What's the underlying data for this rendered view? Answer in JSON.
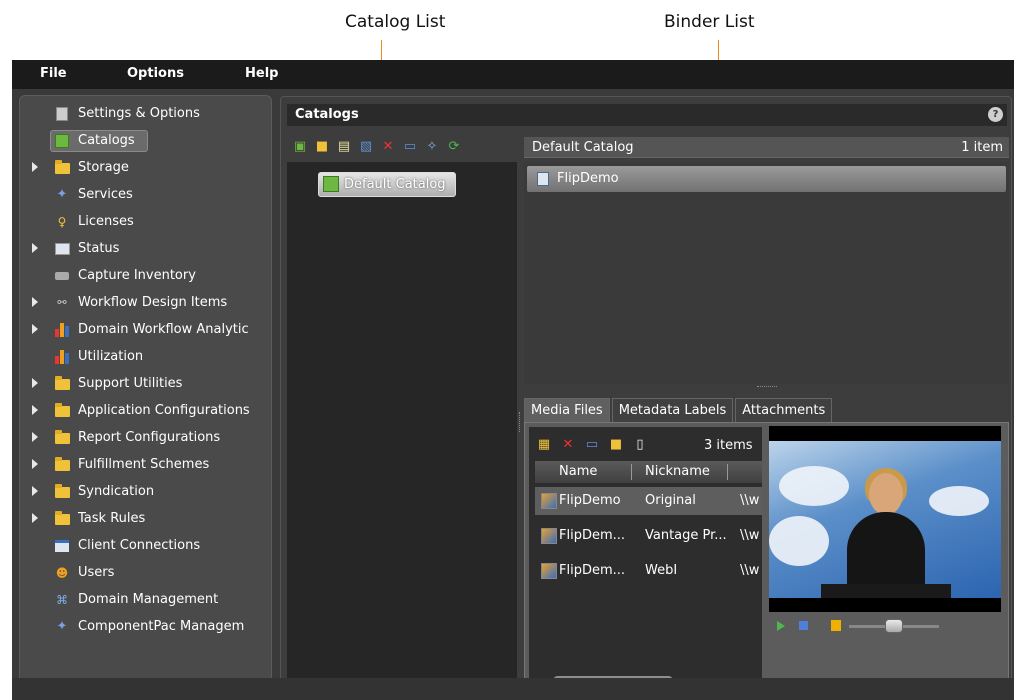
{
  "callouts": {
    "catalog_list": "Catalog List",
    "binder_list": "Binder List"
  },
  "menu": {
    "file": "File",
    "options": "Options",
    "help": "Help"
  },
  "nav": {
    "items": [
      {
        "label": "Settings & Options",
        "icon": "settings-icon",
        "expandable": false
      },
      {
        "label": "Catalogs",
        "icon": "catalogs-icon",
        "expandable": false,
        "selected": true
      },
      {
        "label": "Storage",
        "icon": "folder-icon",
        "expandable": true
      },
      {
        "label": "Services",
        "icon": "services-icon",
        "expandable": false
      },
      {
        "label": "Licenses",
        "icon": "key-icon",
        "expandable": false
      },
      {
        "label": "Status",
        "icon": "chart-icon",
        "expandable": true
      },
      {
        "label": "Capture Inventory",
        "icon": "camera-icon",
        "expandable": false
      },
      {
        "label": "Workflow Design Items",
        "icon": "workflow-icon",
        "expandable": true
      },
      {
        "label": "Domain Workflow Analytic",
        "icon": "bars-icon",
        "expandable": true
      },
      {
        "label": "Utilization",
        "icon": "bars-icon",
        "expandable": false
      },
      {
        "label": "Support Utilities",
        "icon": "folder-icon",
        "expandable": true
      },
      {
        "label": "Application Configurations",
        "icon": "folder-icon",
        "expandable": true
      },
      {
        "label": "Report Configurations",
        "icon": "folder-icon",
        "expandable": true
      },
      {
        "label": "Fulfillment Schemes",
        "icon": "folder-icon",
        "expandable": true
      },
      {
        "label": "Syndication",
        "icon": "folder-icon",
        "expandable": true
      },
      {
        "label": "Task Rules",
        "icon": "folder-icon",
        "expandable": true
      },
      {
        "label": "Client Connections",
        "icon": "window-icon",
        "expandable": false
      },
      {
        "label": "Users",
        "icon": "users-icon",
        "expandable": false
      },
      {
        "label": "Domain Management",
        "icon": "network-icon",
        "expandable": false
      },
      {
        "label": "ComponentPac Managem",
        "icon": "services-icon",
        "expandable": false
      }
    ]
  },
  "main": {
    "title": "Catalogs",
    "help_label": "?",
    "catalog_item": "Default Catalog",
    "binder_header": {
      "title": "Default Catalog",
      "count": "1 item"
    },
    "binder_item": "FlipDemo",
    "tabs": [
      "Media Files",
      "Metadata Labels",
      "Attachments"
    ],
    "media": {
      "count": "3 items",
      "columns": [
        "Name",
        "Nickname"
      ],
      "rows": [
        {
          "name": "FlipDemo",
          "nickname": "Original",
          "path": "\\\\w"
        },
        {
          "name": "FlipDem...",
          "nickname": "Vantage Pr...",
          "path": "\\\\w"
        },
        {
          "name": "FlipDem...",
          "nickname": "WebI",
          "path": "\\\\w"
        }
      ]
    }
  },
  "colors": {
    "accent_callout": "#f08a1c",
    "menubar": "#1b1b1b",
    "panel": "#3a3a3a"
  }
}
